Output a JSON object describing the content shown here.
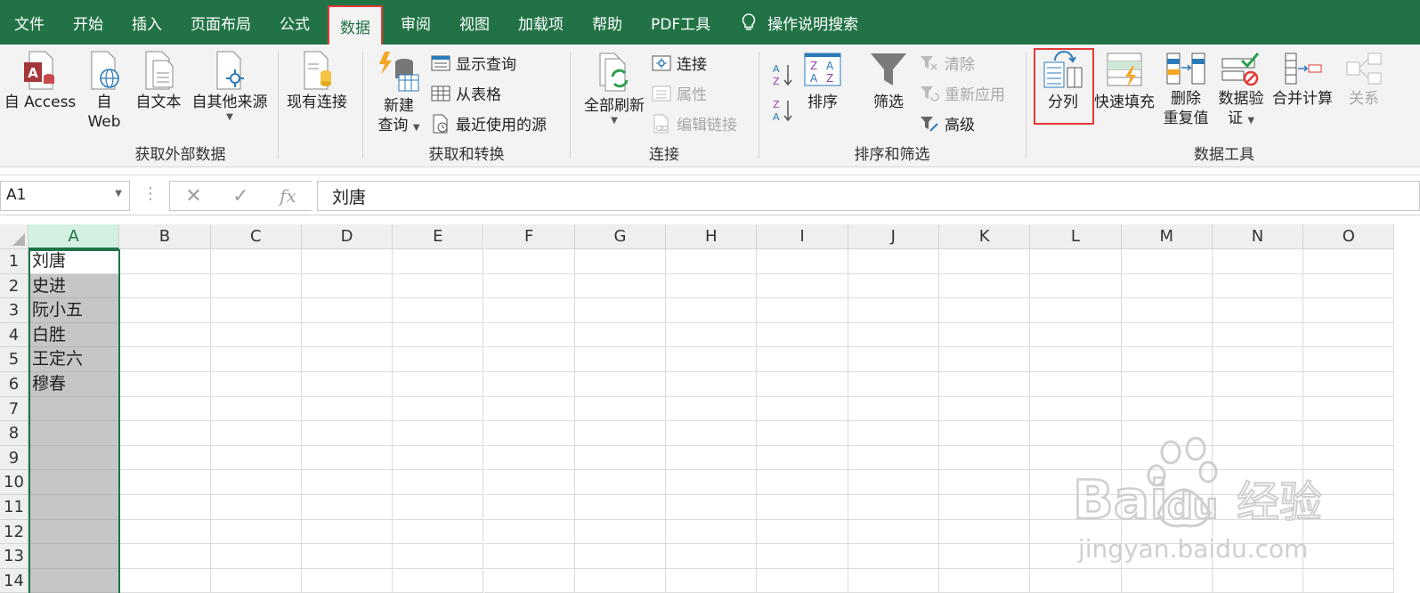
{
  "tabs": [
    "文件",
    "开始",
    "插入",
    "页面布局",
    "公式",
    "数据",
    "审阅",
    "视图",
    "加载项",
    "帮助",
    "PDF工具"
  ],
  "active_tab_index": 5,
  "search_tab": "操作说明搜索",
  "groups": {
    "external": {
      "label": "获取外部数据",
      "access": "自 Access",
      "web_line1": "自",
      "web_line2": "Web",
      "text": "自文本",
      "other": "自其他来源",
      "existing": "现有连接"
    },
    "transform": {
      "label": "获取和转换",
      "new_query_line1": "新建",
      "new_query_line2": "查询",
      "show_query": "显示查询",
      "from_table": "从表格",
      "recent_source": "最近使用的源"
    },
    "connections": {
      "label": "连接",
      "refresh_all": "全部刷新",
      "connections": "连接",
      "properties": "属性",
      "edit_links": "编辑链接"
    },
    "sort_filter": {
      "label": "排序和筛选",
      "sort": "排序",
      "filter": "筛选",
      "clear": "清除",
      "reapply": "重新应用",
      "advanced": "高级"
    },
    "data_tools": {
      "label": "数据工具",
      "text_to_columns": "分列",
      "flash_fill": "快速填充",
      "remove_dup_line1": "删除",
      "remove_dup_line2": "重复值",
      "validation_line1": "数据验",
      "validation_line2": "证",
      "consolidate": "合并计算",
      "relationships": "关系"
    }
  },
  "formula_bar": {
    "name_box": "A1",
    "fx": "fx",
    "content": "刘唐"
  },
  "grid": {
    "columns": [
      "A",
      "B",
      "C",
      "D",
      "E",
      "F",
      "G",
      "H",
      "I",
      "J",
      "K",
      "L",
      "M",
      "N",
      "O"
    ],
    "rows": [
      "1",
      "2",
      "3",
      "4",
      "5",
      "6",
      "7",
      "8",
      "9",
      "10",
      "11",
      "12",
      "13",
      "14"
    ],
    "col_a_values": [
      "刘唐",
      "史进",
      "阮小五",
      "白胜",
      "王定六",
      "穆春"
    ]
  },
  "watermark": {
    "line1": "Bai",
    "line2": "du",
    "cn": "经验",
    "url": "jingyan.baidu.com"
  },
  "colors": {
    "excel_green": "#217346",
    "highlight_red": "#e53935"
  }
}
